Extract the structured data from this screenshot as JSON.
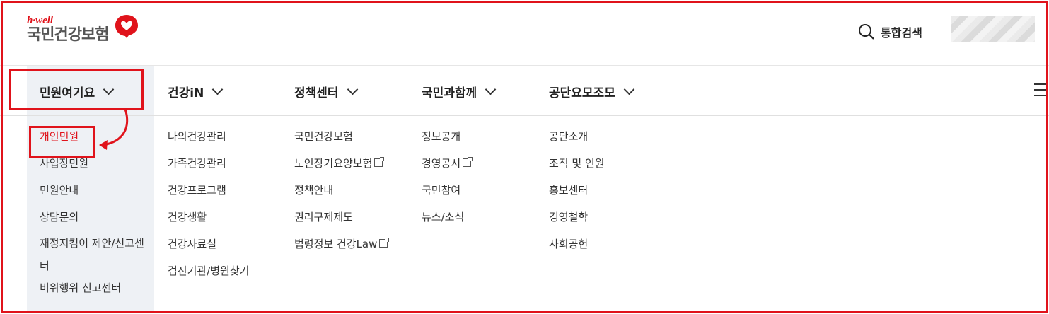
{
  "logo": {
    "sub": "h·well",
    "main": "국민건강보험"
  },
  "header": {
    "search_label": "통합검색"
  },
  "nav": [
    {
      "label": "민원여기요"
    },
    {
      "label": "건강iN"
    },
    {
      "label": "정책센터"
    },
    {
      "label": "국민과함께"
    },
    {
      "label": "공단요모조모"
    }
  ],
  "columns": [
    {
      "items": [
        {
          "label": "개인민원",
          "active": true
        },
        {
          "label": "사업장민원"
        },
        {
          "label": "민원안내"
        },
        {
          "label": "상담문의"
        },
        {
          "label": "재정지킴이 제안/신고센터"
        },
        {
          "label": "비위행위 신고센터"
        }
      ]
    },
    {
      "items": [
        {
          "label": "나의건강관리"
        },
        {
          "label": "가족건강관리"
        },
        {
          "label": "건강프로그램"
        },
        {
          "label": "건강생활"
        },
        {
          "label": "건강자료실"
        },
        {
          "label": "검진기관/병원찾기"
        }
      ]
    },
    {
      "items": [
        {
          "label": "국민건강보험"
        },
        {
          "label": "노인장기요양보험"
        },
        {
          "label": "정책안내"
        },
        {
          "label": "권리구제제도"
        },
        {
          "label": "법령정보 건강Law"
        }
      ]
    },
    {
      "items": [
        {
          "label": "정보공개"
        },
        {
          "label": "경영공시"
        },
        {
          "label": "국민참여"
        },
        {
          "label": "뉴스/소식"
        }
      ]
    },
    {
      "items": [
        {
          "label": "공단소개"
        },
        {
          "label": "조직 및 인원"
        },
        {
          "label": "홍보센터"
        },
        {
          "label": "경영철학"
        },
        {
          "label": "사회공헌"
        }
      ]
    }
  ],
  "colors": {
    "accent": "#e0131b",
    "side_bg": "#eef1f5"
  },
  "icons": [
    "heart-logo-icon",
    "search-icon",
    "chevron-down-icon",
    "external-link-icon",
    "hamburger-menu-icon"
  ]
}
